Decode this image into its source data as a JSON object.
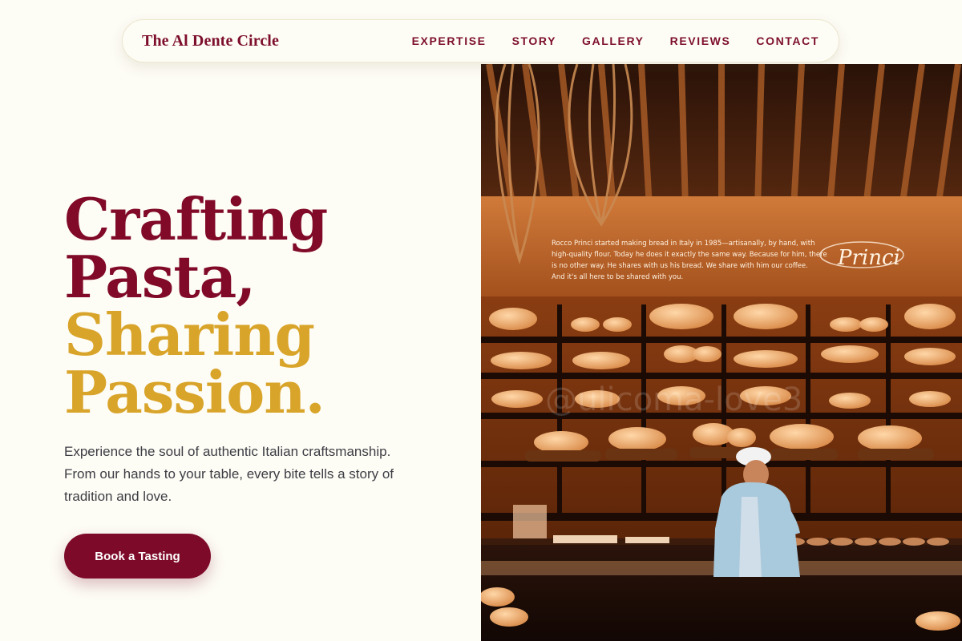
{
  "brand": "The Al Dente Circle",
  "nav": {
    "items": [
      "EXPERTISE",
      "STORY",
      "GALLERY",
      "REVIEWS",
      "CONTACT"
    ]
  },
  "hero": {
    "title_line1": "Crafting",
    "title_line2": "Pasta,",
    "title_line3": "Sharing",
    "title_line4": "Passion.",
    "description": "Experience the soul of authentic Italian craftsmanship. From our hands to your table, every bite tells a story of tradition and love.",
    "cta_label": "Book a Tasting"
  },
  "image": {
    "sign_text": [
      "Rocco Princi started making bread in Italy in 1985—artisanally, by hand, with",
      "high-quality flour. Today he does it exactly the same way. Because for him, there",
      "is no other way. He shares with us his bread. We share with him our coffee.",
      "And it's all here to be shared with you."
    ],
    "signature": "Princi",
    "watermark": "@ulicoma-love3"
  },
  "colors": {
    "background": "#fdfcf5",
    "primary": "#7d0a28",
    "accent": "#d9a42a",
    "text": "#3d3d44"
  }
}
